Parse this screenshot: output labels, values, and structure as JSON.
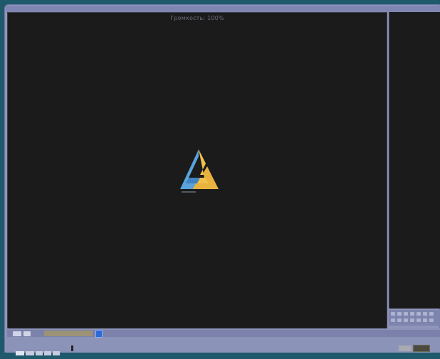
{
  "window": {
    "status_text": "Громкость: 100%"
  },
  "player": {
    "logo_icon": "aimp-logo-icon",
    "seek_progress": 0.13
  },
  "playlist": {
    "toolbar_icon": "playlist-toolbar-icon"
  },
  "colors": {
    "background": "#1f5a6c",
    "video": "#1b1b1c",
    "frame": "#8f95bb",
    "accent": "#2e6ad4",
    "logo_blue": "#5aa3db",
    "logo_yellow": "#f2c14b"
  }
}
